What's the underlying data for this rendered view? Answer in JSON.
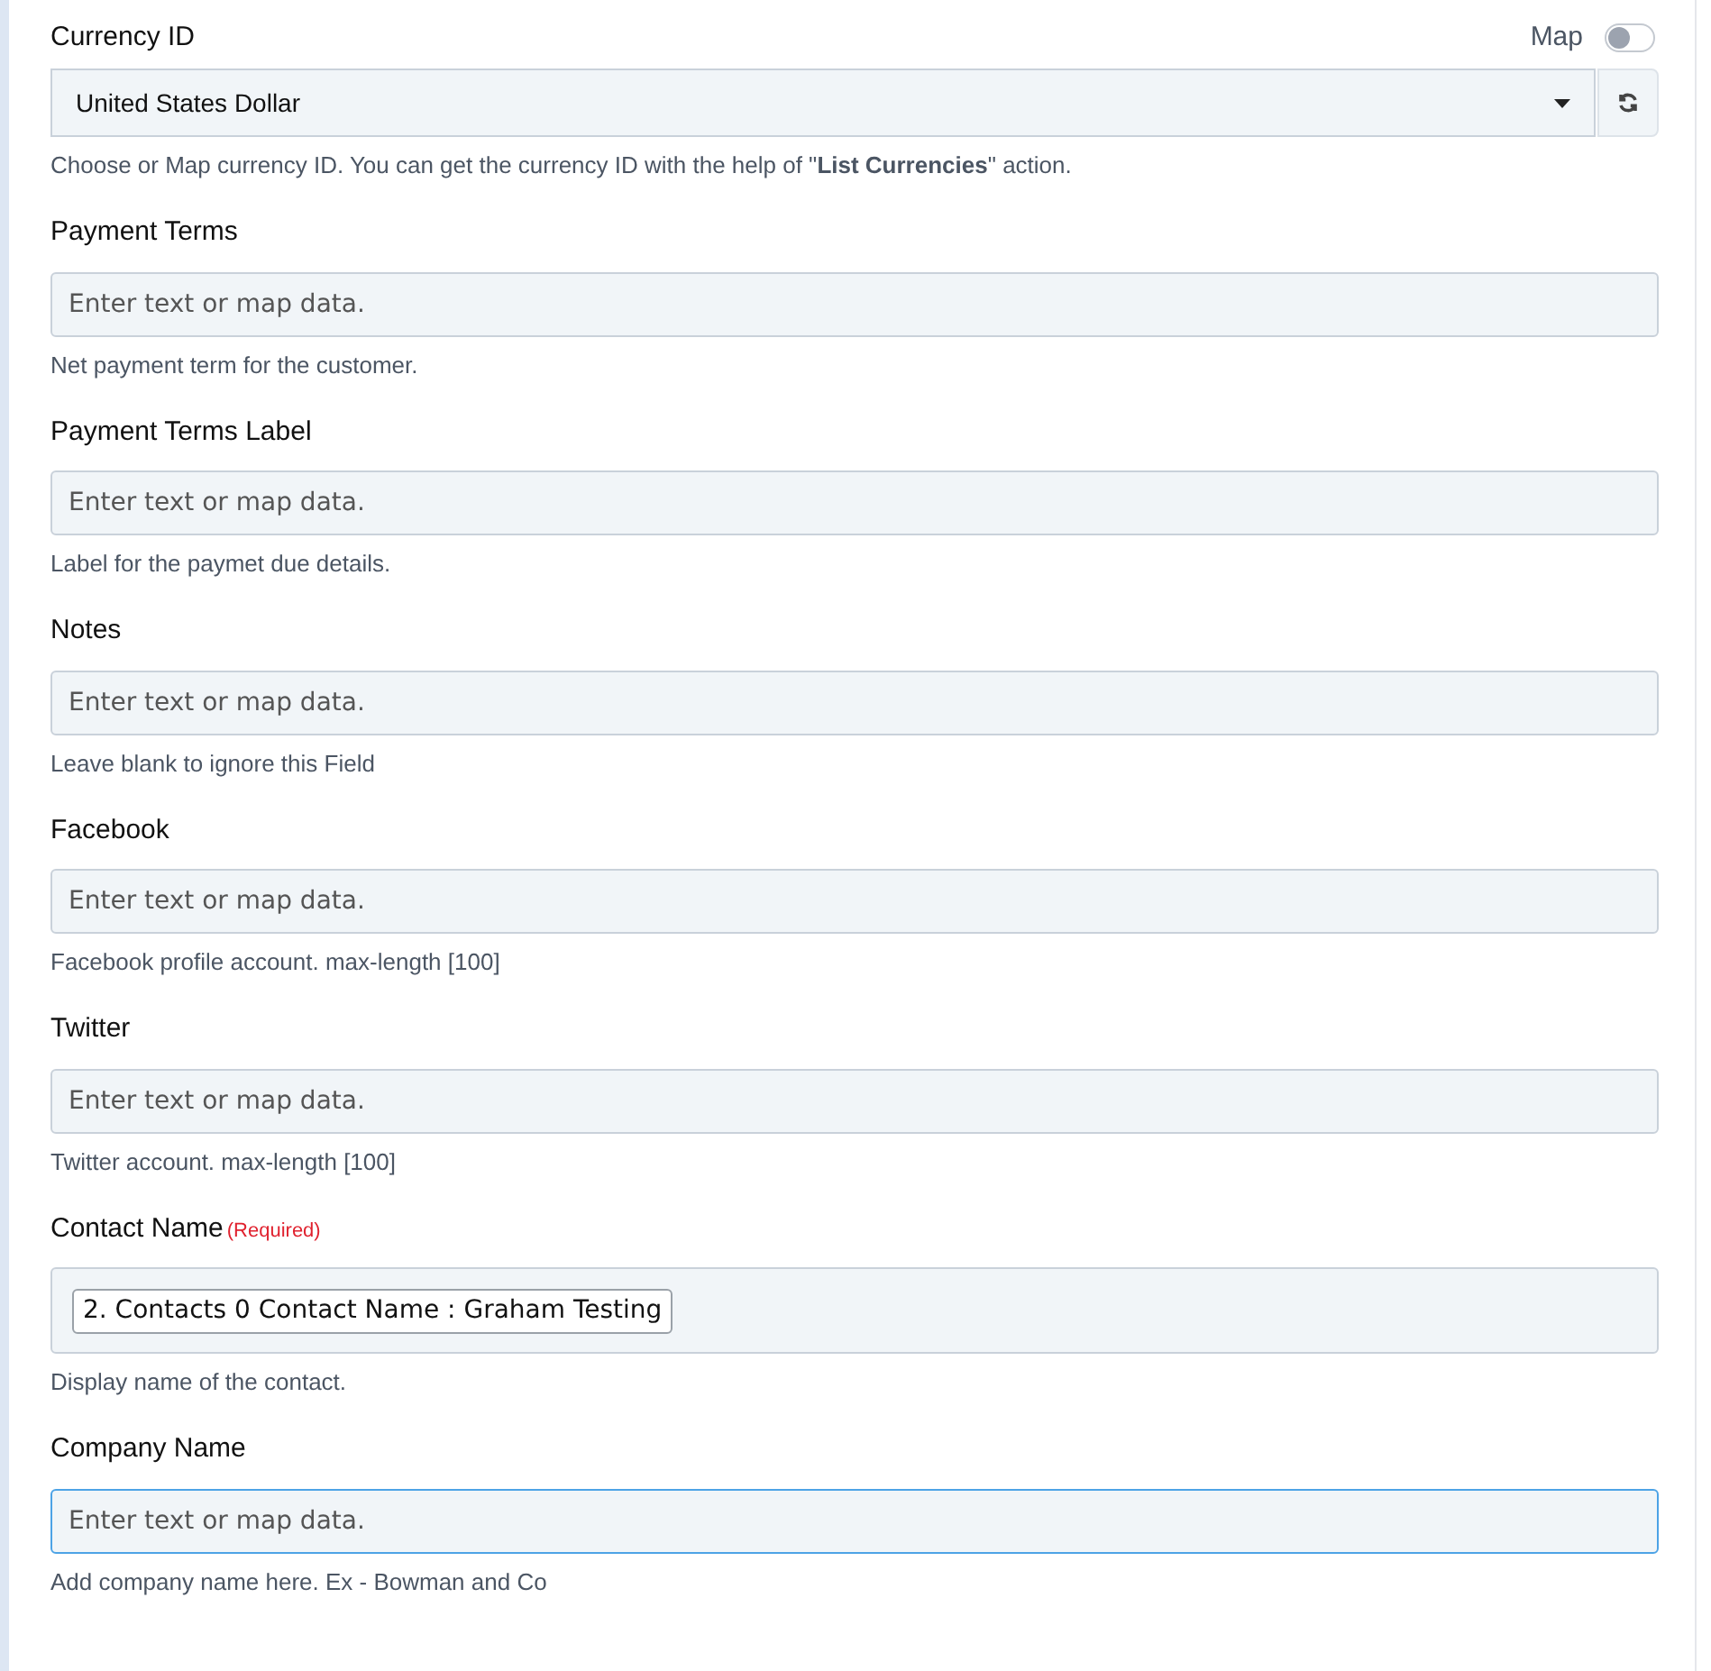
{
  "fields": [
    {
      "kind": "select",
      "label": "Currency ID",
      "map_toggle": {
        "label": "Map",
        "on": false
      },
      "value": "United States Dollar",
      "help": "Choose or Map currency ID. You can get the currency ID with the help of \"**List Currencies**\" action."
    },
    {
      "kind": "text",
      "label": "Payment Terms",
      "placeholder": "Enter text or map data.",
      "focused": false,
      "help": "Net payment term for the customer."
    },
    {
      "kind": "text",
      "label": "Payment Terms Label",
      "placeholder": "Enter text or map data.",
      "focused": false,
      "help": "Label for the paymet due details."
    },
    {
      "kind": "text",
      "label": "Notes",
      "placeholder": "Enter text or map data.",
      "focused": false,
      "help": "Leave blank to ignore this Field"
    },
    {
      "kind": "text",
      "label": "Facebook",
      "placeholder": "Enter text or map data.",
      "focused": false,
      "help": "Facebook profile account. max-length [100]"
    },
    {
      "kind": "text",
      "label": "Twitter",
      "placeholder": "Enter text or map data.",
      "focused": false,
      "help": "Twitter account. max-length [100]"
    },
    {
      "kind": "mapped",
      "label": "Contact Name",
      "required": "(Required)",
      "chip": "2. Contacts 0 Contact Name : Graham Testing",
      "help": "Display name of the contact."
    },
    {
      "kind": "text",
      "label": "Company Name",
      "placeholder": "Enter text or map data.",
      "focused": true,
      "help": "Add company name here. Ex - Bowman and Co"
    }
  ]
}
